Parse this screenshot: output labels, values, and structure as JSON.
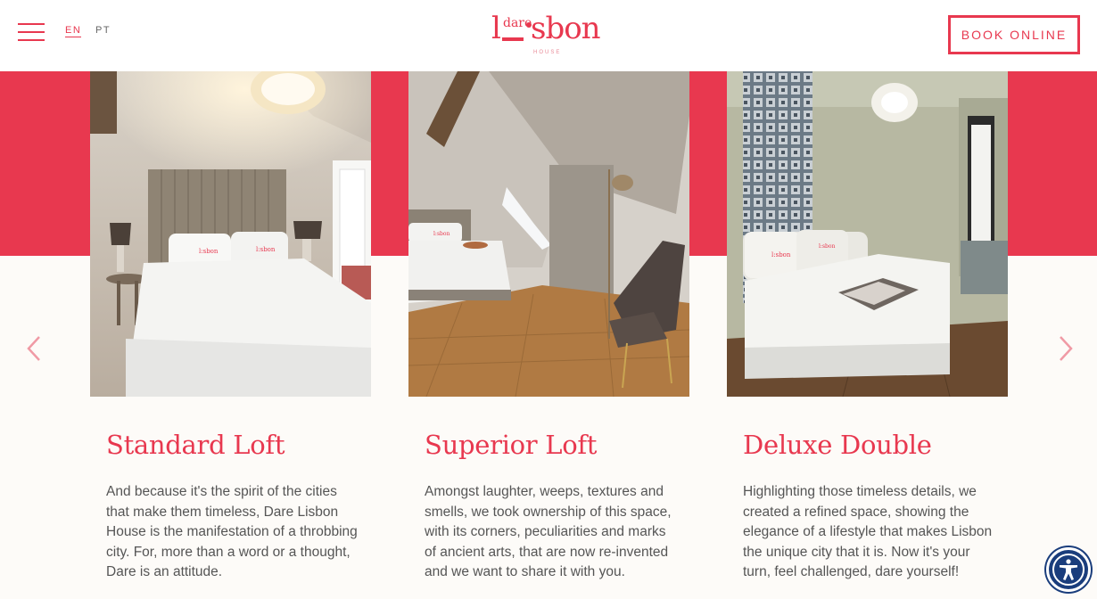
{
  "header": {
    "menu_icon": "hamburger-icon",
    "languages": [
      "EN",
      "PT"
    ],
    "active_language": "EN",
    "logo": {
      "first_letter": "l",
      "superscript": "dare",
      "rest": "sbon",
      "subtitle": "HOUSE"
    },
    "book_label": "BOOK ONLINE"
  },
  "colors": {
    "accent": "#e8384f",
    "background": "#fdfbf8",
    "a11y": "#1a3d7c"
  },
  "carousel": {
    "prev_icon": "chevron-left-icon",
    "next_icon": "chevron-right-icon"
  },
  "rooms": [
    {
      "title": "Standard Loft",
      "description": "And because it's the spirit of the cities that make them timeless, Dare Lisbon House is the manifestation of a throbbing city. For, more than a word or a thought, Dare is an attitude."
    },
    {
      "title": "Superior Loft",
      "description": "Amongst laughter, weeps, textures and smells, we took ownership of this space, with its corners, peculiarities and marks of ancient arts, that are now re-invented and we want to share it with you."
    },
    {
      "title": "Deluxe Double",
      "description": "Highlighting those timeless details, we created a refined space, showing the elegance of a lifestyle that makes Lisbon the unique city that it is. Now it's your turn, feel challenged, dare yourself!"
    }
  ],
  "accessibility": {
    "icon": "accessibility-icon"
  }
}
